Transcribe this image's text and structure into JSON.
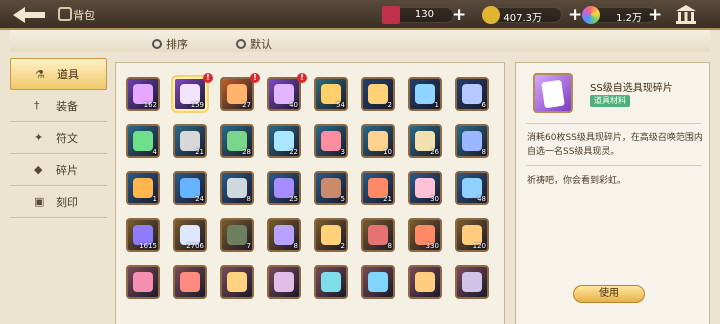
{
  "header": {
    "title": "背包",
    "resources": [
      {
        "name": "ticket",
        "value": "130",
        "icon": "ticket-icon",
        "color": "#c0304a"
      },
      {
        "name": "gold",
        "value": "407.3万",
        "icon": "gold-coin-icon",
        "color": "#e2b531"
      },
      {
        "name": "gem",
        "value": "1.2万",
        "icon": "rainbow-gem-icon",
        "color": "#b36be0"
      }
    ]
  },
  "sort": {
    "sort_label": "排序",
    "default_label": "默认"
  },
  "tabs": [
    {
      "label": "道具",
      "icon": "flask-icon",
      "active": true
    },
    {
      "label": "装备",
      "icon": "sword-icon",
      "active": false
    },
    {
      "label": "符文",
      "icon": "rune-icon",
      "active": false
    },
    {
      "label": "碎片",
      "icon": "shard-icon",
      "active": false
    },
    {
      "label": "刻印",
      "icon": "seal-icon",
      "active": false
    }
  ],
  "items": [
    {
      "count": "162",
      "color": "#6a3fb0",
      "alert": false
    },
    {
      "count": "159",
      "color": "#7e48c6",
      "alert": true,
      "selected": true
    },
    {
      "count": "27",
      "color": "#c0602a",
      "alert": true
    },
    {
      "count": "40",
      "color": "#7e48c6",
      "alert": true
    },
    {
      "count": "54",
      "color": "#2f6b7a",
      "alert": false
    },
    {
      "count": "2",
      "color": "#23406a",
      "alert": false
    },
    {
      "count": "1",
      "color": "#23406a",
      "alert": false
    },
    {
      "count": "6",
      "color": "#23406a",
      "alert": false
    },
    {
      "count": "4",
      "color": "#2a6a8a",
      "alert": false
    },
    {
      "count": "21",
      "color": "#2a6a8a",
      "alert": false
    },
    {
      "count": "28",
      "color": "#2a6a8a",
      "alert": false
    },
    {
      "count": "22",
      "color": "#2a6a8a",
      "alert": false
    },
    {
      "count": "3",
      "color": "#2a6a8a",
      "alert": false
    },
    {
      "count": "10",
      "color": "#2a6a8a",
      "alert": false
    },
    {
      "count": "26",
      "color": "#2a6a8a",
      "alert": false
    },
    {
      "count": "8",
      "color": "#2a6a8a",
      "alert": false
    },
    {
      "count": "1",
      "color": "#2a5a8a",
      "alert": false
    },
    {
      "count": "24",
      "color": "#2a5a8a",
      "alert": false
    },
    {
      "count": "8",
      "color": "#2a5a8a",
      "alert": false
    },
    {
      "count": "25",
      "color": "#2a5a8a",
      "alert": false
    },
    {
      "count": "5",
      "color": "#2a5a8a",
      "alert": false
    },
    {
      "count": "21",
      "color": "#2a5a8a",
      "alert": false
    },
    {
      "count": "30",
      "color": "#2a5a8a",
      "alert": false
    },
    {
      "count": "48",
      "color": "#2a5a8a",
      "alert": false
    },
    {
      "count": "1615",
      "color": "#7a5a2a",
      "alert": false
    },
    {
      "count": "2706",
      "color": "#7a5a2a",
      "alert": false
    },
    {
      "count": "7",
      "color": "#7a5a2a",
      "alert": false
    },
    {
      "count": "8",
      "color": "#7a5a2a",
      "alert": false
    },
    {
      "count": "2",
      "color": "#7a5a2a",
      "alert": false
    },
    {
      "count": "8",
      "color": "#7a5a2a",
      "alert": false
    },
    {
      "count": "330",
      "color": "#7a5a2a",
      "alert": false
    },
    {
      "count": "120",
      "color": "#7a5a2a",
      "alert": false
    },
    {
      "count": "",
      "color": "#7a4a5a",
      "alert": false
    },
    {
      "count": "",
      "color": "#7a4a5a",
      "alert": false
    },
    {
      "count": "",
      "color": "#7a4a5a",
      "alert": false
    },
    {
      "count": "",
      "color": "#7a4a5a",
      "alert": false
    },
    {
      "count": "",
      "color": "#7a4a5a",
      "alert": false
    },
    {
      "count": "",
      "color": "#7a4a5a",
      "alert": false
    },
    {
      "count": "",
      "color": "#7a4a5a",
      "alert": false
    },
    {
      "count": "",
      "color": "#7a4a5a",
      "alert": false
    }
  ],
  "detail": {
    "name": "SS级自选具现碎片",
    "type": "道具材料",
    "description": "消耗60枚SS级具现碎片，在高级召唤范围内自选一名SS级具现灵。",
    "flavor": "祈祷吧，你会看到彩虹。",
    "use_label": "使用"
  }
}
